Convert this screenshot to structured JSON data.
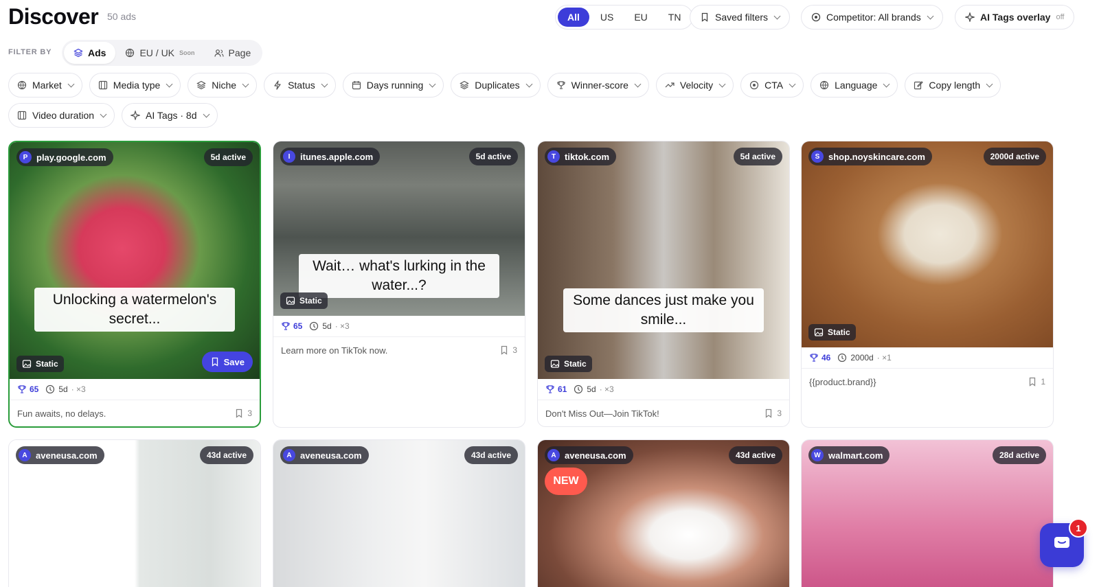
{
  "header": {
    "title": "Discover",
    "count": "50 ads",
    "markets": [
      "All",
      "US",
      "EU",
      "TN"
    ],
    "saved_filters": "Saved filters",
    "competitor": "Competitor: All brands",
    "ai_tags_overlay": "AI Tags overlay",
    "ai_tags_overlay_state": "off"
  },
  "filter_by": {
    "label": "FILTER BY",
    "options": [
      {
        "label": "Ads",
        "icon": "layers-icon",
        "active": true
      },
      {
        "label": "EU / UK",
        "icon": "globe-icon",
        "tag": "Soon"
      },
      {
        "label": "Page",
        "icon": "users-icon"
      }
    ]
  },
  "filters": [
    {
      "label": "Market",
      "icon": "globe-icon"
    },
    {
      "label": "Media type",
      "icon": "film-icon"
    },
    {
      "label": "Niche",
      "icon": "layers-icon"
    },
    {
      "label": "Status",
      "icon": "bolt-icon"
    },
    {
      "label": "Days running",
      "icon": "calendar-icon"
    },
    {
      "label": "Duplicates",
      "icon": "layers-icon"
    },
    {
      "label": "Winner-score",
      "icon": "trophy-icon"
    },
    {
      "label": "Velocity",
      "icon": "trend-icon"
    },
    {
      "label": "CTA",
      "icon": "target-icon"
    },
    {
      "label": "Language",
      "icon": "globe-icon"
    },
    {
      "label": "Copy length",
      "icon": "edit-icon"
    },
    {
      "label": "Video duration",
      "icon": "film-icon"
    },
    {
      "label": "AI Tags · 8d",
      "icon": "sparkle-icon"
    }
  ],
  "cards_row1": [
    {
      "letter": "P",
      "domain": "play.google.com",
      "active": "5d active",
      "caption": "Unlocking a watermelon's secret...",
      "badge": "Static",
      "save": "Save",
      "score": "65",
      "days": "5d",
      "dup": "· ×3",
      "text": "Fun awaits, no delays.",
      "saves": "3"
    },
    {
      "letter": "I",
      "domain": "itunes.apple.com",
      "active": "5d active",
      "caption": "Wait… what's lurking in the water...?",
      "badge": "Static",
      "score": "65",
      "days": "5d",
      "dup": "· ×3",
      "text": "Learn more on TikTok now.",
      "saves": "3"
    },
    {
      "letter": "T",
      "domain": "tiktok.com",
      "active": "5d active",
      "caption": "Some dances just make you smile...",
      "badge": "Static",
      "score": "61",
      "days": "5d",
      "dup": "· ×3",
      "text": "Don't Miss Out—Join TikTok!",
      "saves": "3"
    },
    {
      "letter": "S",
      "domain": "shop.noyskincare.com",
      "active": "2000d active",
      "badge": "Static",
      "score": "46",
      "days": "2000d",
      "dup": "· ×1",
      "text": "{{product.brand}}",
      "saves": "1"
    }
  ],
  "cards_row2": [
    {
      "letter": "A",
      "domain": "aveneusa.com",
      "active": "43d active"
    },
    {
      "letter": "A",
      "domain": "aveneusa.com",
      "active": "43d active"
    },
    {
      "letter": "A",
      "domain": "aveneusa.com",
      "active": "43d active",
      "new": "NEW"
    },
    {
      "letter": "W",
      "domain": "walmart.com",
      "active": "28d active"
    }
  ],
  "chat": {
    "badge": "1"
  },
  "colors": {
    "accent": "#3d3dd9",
    "new_badge": "#ff5a4e",
    "chat_badge": "#e5242b"
  }
}
